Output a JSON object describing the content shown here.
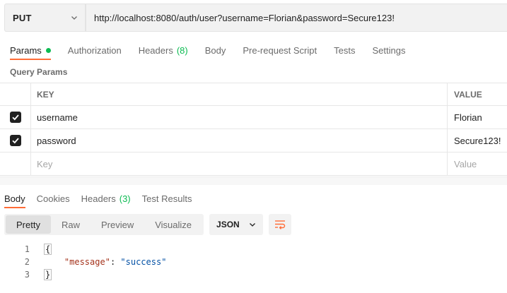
{
  "request": {
    "method": "PUT",
    "url": "http://localhost:8080/auth/user?username=Florian&password=Secure123!"
  },
  "request_tabs": [
    {
      "label": "Params",
      "active": true,
      "has_dot": true
    },
    {
      "label": "Authorization"
    },
    {
      "label": "Headers",
      "count": "(8)"
    },
    {
      "label": "Body"
    },
    {
      "label": "Pre-request Script"
    },
    {
      "label": "Tests"
    },
    {
      "label": "Settings"
    }
  ],
  "query_params": {
    "title": "Query Params",
    "columns": {
      "key": "KEY",
      "value": "VALUE"
    },
    "rows": [
      {
        "checked": true,
        "key": "username",
        "value": "Florian"
      },
      {
        "checked": true,
        "key": "password",
        "value": "Secure123!"
      }
    ],
    "empty_row": {
      "key_placeholder": "Key",
      "value_placeholder": "Value"
    }
  },
  "response_tabs": [
    {
      "label": "Body",
      "active": true
    },
    {
      "label": "Cookies"
    },
    {
      "label": "Headers",
      "count": "(3)"
    },
    {
      "label": "Test Results"
    }
  ],
  "view_modes": [
    "Pretty",
    "Raw",
    "Preview",
    "Visualize"
  ],
  "selected_view": "Pretty",
  "format": "JSON",
  "code_lines": [
    {
      "num": "1",
      "text": "{"
    },
    {
      "num": "2",
      "key": "\"message\"",
      "sep": ": ",
      "value": "\"success\""
    },
    {
      "num": "3",
      "text": "}"
    }
  ],
  "colors": {
    "accent": "#ff6c37",
    "success": "#0cbb52"
  }
}
